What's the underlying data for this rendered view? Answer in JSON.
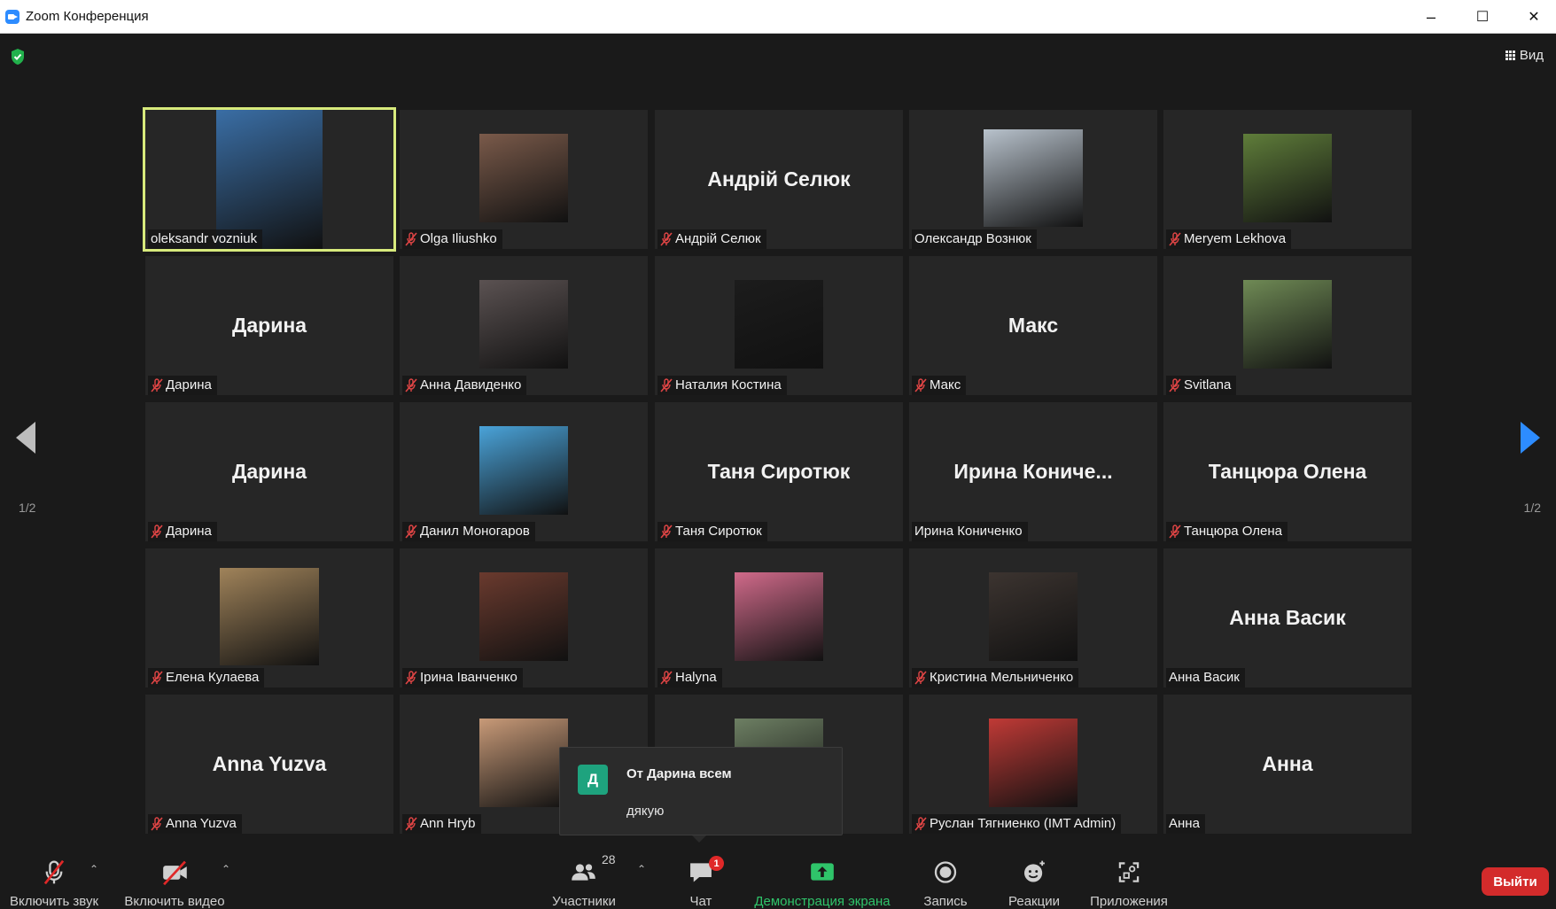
{
  "window": {
    "title": "Zoom Конференция",
    "minimize": "–",
    "maximize": "☐",
    "close": "✕"
  },
  "header": {
    "view_label": "Вид"
  },
  "pager": {
    "left": "1/2",
    "right": "1/2"
  },
  "tiles": [
    {
      "name": "oleksandr vozniuk",
      "big": "",
      "photo": "#3a6ea5",
      "muted": false,
      "active": true
    },
    {
      "name": "Olga Iliushko",
      "big": "",
      "photo": "#7a5a4a",
      "muted": true
    },
    {
      "name": "Андрій Селюк",
      "big": "Андрій Селюк",
      "photo": "",
      "muted": true
    },
    {
      "name": "Олександр Вознюк",
      "big": "",
      "photo": "#b8c2cc",
      "muted": false
    },
    {
      "name": "Meryem Lekhova",
      "big": "",
      "photo": "#5f7d3a",
      "muted": true
    },
    {
      "name": "Дарина",
      "big": "Дарина",
      "photo": "",
      "muted": true
    },
    {
      "name": "Анна Давиденко",
      "big": "",
      "photo": "#5b5252",
      "muted": true
    },
    {
      "name": "Наталия Костина",
      "big": "",
      "photo": "#1c1c1c",
      "muted": true
    },
    {
      "name": "Макс",
      "big": "Макс",
      "photo": "",
      "muted": true
    },
    {
      "name": "Svitlana",
      "big": "",
      "photo": "#6f8a55",
      "muted": true
    },
    {
      "name": "Дарина",
      "big": "Дарина",
      "photo": "",
      "muted": true
    },
    {
      "name": "Данил Моногаров",
      "big": "",
      "photo": "#4aa3d9",
      "muted": true
    },
    {
      "name": "Таня Сиротюк",
      "big": "Таня Сиротюк",
      "photo": "",
      "muted": true
    },
    {
      "name": "Ирина Кониченко",
      "big": "Ирина  Кониче...",
      "photo": "",
      "muted": false
    },
    {
      "name": "Танцюра Олена",
      "big": "Танцюра Олена",
      "photo": "",
      "muted": true
    },
    {
      "name": "Елена Кулаева",
      "big": "",
      "photo": "#a0835a",
      "muted": true
    },
    {
      "name": "Ірина Іванченко",
      "big": "",
      "photo": "#6a3a2e",
      "muted": true
    },
    {
      "name": "Halyna",
      "big": "",
      "photo": "#d06a8a",
      "muted": true
    },
    {
      "name": "Кристина Мельниченко",
      "big": "",
      "photo": "#3c3430",
      "muted": true
    },
    {
      "name": "Анна Васик",
      "big": "Анна Васик",
      "photo": "",
      "muted": false
    },
    {
      "name": "Anna Yuzva",
      "big": "Anna Yuzva",
      "photo": "",
      "muted": true
    },
    {
      "name": "Ann Hryb",
      "big": "",
      "photo": "#c89a78",
      "muted": true
    },
    {
      "name": "",
      "big": "",
      "photo": "#6d7f63",
      "muted": false
    },
    {
      "name": "Руслан Тягниенко (IMT Admin)",
      "big": "",
      "photo": "#c03a36",
      "muted": true
    },
    {
      "name": "Анна",
      "big": "Анна",
      "photo": "",
      "muted": false
    }
  ],
  "chat_toast": {
    "avatar_letter": "Д",
    "from": "От Дарина всем",
    "message": "дякую"
  },
  "toolbar": {
    "unmute": "Включить звук",
    "start_video": "Включить видео",
    "participants": "Участники",
    "participants_count": "28",
    "chat": "Чат",
    "chat_badge": "1",
    "share": "Демонстрация экрана",
    "record": "Запись",
    "reactions": "Реакции",
    "apps": "Приложения",
    "leave": "Выйти"
  },
  "colors": {
    "active_speaker": "#d7ea7c",
    "share_green": "#2fc46a",
    "leave_red": "#d32b2b",
    "accent_blue": "#2d8cff"
  }
}
